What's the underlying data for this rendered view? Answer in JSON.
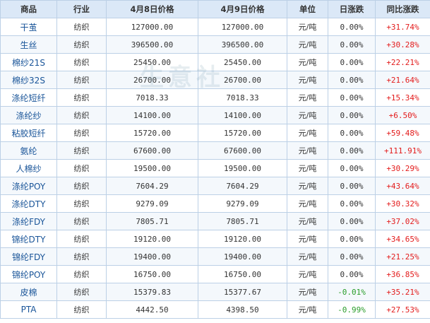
{
  "table": {
    "headers": [
      "商品",
      "行业",
      "4月8日价格",
      "4月9日价格",
      "单位",
      "日涨跌",
      "同比涨跌"
    ],
    "rows": [
      [
        "干茧",
        "纺织",
        "127000.00",
        "127000.00",
        "元/吨",
        "0.00%",
        "+31.74%"
      ],
      [
        "生丝",
        "纺织",
        "396500.00",
        "396500.00",
        "元/吨",
        "0.00%",
        "+30.28%"
      ],
      [
        "棉纱21S",
        "纺织",
        "25450.00",
        "25450.00",
        "元/吨",
        "0.00%",
        "+22.21%"
      ],
      [
        "棉纱32S",
        "纺织",
        "26700.00",
        "26700.00",
        "元/吨",
        "0.00%",
        "+21.64%"
      ],
      [
        "涤纶短纤",
        "纺织",
        "7018.33",
        "7018.33",
        "元/吨",
        "0.00%",
        "+15.34%"
      ],
      [
        "涤纶纱",
        "纺织",
        "14100.00",
        "14100.00",
        "元/吨",
        "0.00%",
        "+6.50%"
      ],
      [
        "粘胶短纤",
        "纺织",
        "15720.00",
        "15720.00",
        "元/吨",
        "0.00%",
        "+59.48%"
      ],
      [
        "氨纶",
        "纺织",
        "67600.00",
        "67600.00",
        "元/吨",
        "0.00%",
        "+111.91%"
      ],
      [
        "人棉纱",
        "纺织",
        "19500.00",
        "19500.00",
        "元/吨",
        "0.00%",
        "+30.29%"
      ],
      [
        "涤纶POY",
        "纺织",
        "7604.29",
        "7604.29",
        "元/吨",
        "0.00%",
        "+43.64%"
      ],
      [
        "涤纶DTY",
        "纺织",
        "9279.09",
        "9279.09",
        "元/吨",
        "0.00%",
        "+30.32%"
      ],
      [
        "涤纶FDY",
        "纺织",
        "7805.71",
        "7805.71",
        "元/吨",
        "0.00%",
        "+37.02%"
      ],
      [
        "锦纶DTY",
        "纺织",
        "19120.00",
        "19120.00",
        "元/吨",
        "0.00%",
        "+34.65%"
      ],
      [
        "锦纶FDY",
        "纺织",
        "19400.00",
        "19400.00",
        "元/吨",
        "0.00%",
        "+21.25%"
      ],
      [
        "锦纶POY",
        "纺织",
        "16750.00",
        "16750.00",
        "元/吨",
        "0.00%",
        "+36.85%"
      ],
      [
        "皮棉",
        "纺织",
        "15379.83",
        "15377.67",
        "元/吨",
        "-0.01%",
        "+35.21%"
      ],
      [
        "PTA",
        "纺织",
        "4442.50",
        "4398.50",
        "元/吨",
        "-0.99%",
        "+27.53%"
      ]
    ]
  },
  "watermark": {
    "text": "生意社"
  },
  "colors": {
    "header_bg": "#dbe8f7",
    "border": "#bcd0e6",
    "name_text": "#1a5599",
    "positive": "#e31b1b",
    "negative": "#2a9d2a"
  }
}
